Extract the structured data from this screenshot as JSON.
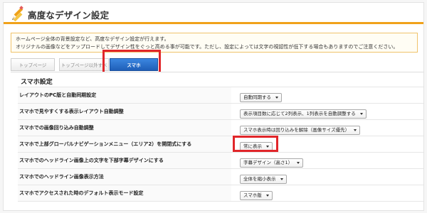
{
  "header": {
    "title": "高度なデザイン設定",
    "accent_color": "#f0a21a",
    "icon": "pencil-icon"
  },
  "notice": {
    "line1": "ホームページ全体の背景設定など、高度なデザイン設定が行えます。",
    "line2": "オリジナルの画像などをアップロードしてデザイン性をぐっと高める事が可能です。ただし、設定によっては文字の視認性が低下する場合もありますのでご注意ください。"
  },
  "tabs": [
    {
      "label": "トップページ"
    },
    {
      "label": "トップページ以外すべて"
    },
    {
      "label": "スマホ",
      "active": true
    }
  ],
  "settings": {
    "title": "スマホ設定",
    "rows": [
      {
        "label": "レイアウトのPC版と自動同期設定",
        "value": "自動同期する"
      },
      {
        "label": "スマホで見やすくする表示レイアウト自動調整",
        "value": "表示項目数に応じて2列表示、1列表示を自動調整する"
      },
      {
        "label": "スマホでの画像回り込み自動調整",
        "value": "スマホ表示時は回り込みを解除（画像サイズ優先）"
      },
      {
        "label": "スマホで上部グローバルナビゲーションメニュー（エリア2）を開閉式にする",
        "value": "常に表示"
      },
      {
        "label": "スマホでのヘッドライン画像上の文字を下部字幕デザインにする",
        "value": "字幕デザイン（高さ1）"
      },
      {
        "label": "スマホでのヘッドライン画像表示方法",
        "value": "全体を縮小表示"
      },
      {
        "label": "スマホでアクセスされた時のデフォルト表示モード設定",
        "value": "スマホ版"
      }
    ]
  },
  "highlight_color": "#e1262a",
  "active_tab_color": "#1f5fb8"
}
